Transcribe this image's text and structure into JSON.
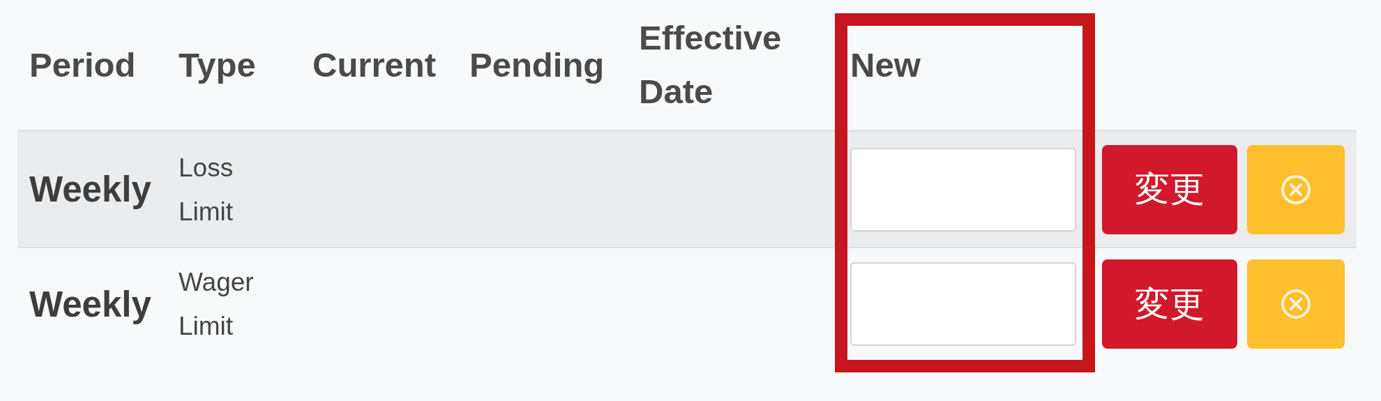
{
  "table": {
    "columns": [
      {
        "label": "Period"
      },
      {
        "label": "Type"
      },
      {
        "label": "Current"
      },
      {
        "label": "Pending"
      },
      {
        "label": "Effective Date"
      },
      {
        "label": "New",
        "highlighted": true
      }
    ],
    "rows": [
      {
        "period": "Weekly",
        "type": "Loss Limit",
        "change_button": "変更"
      },
      {
        "period": "Weekly",
        "type": "Wager Limit",
        "change_button": "変更"
      }
    ]
  }
}
